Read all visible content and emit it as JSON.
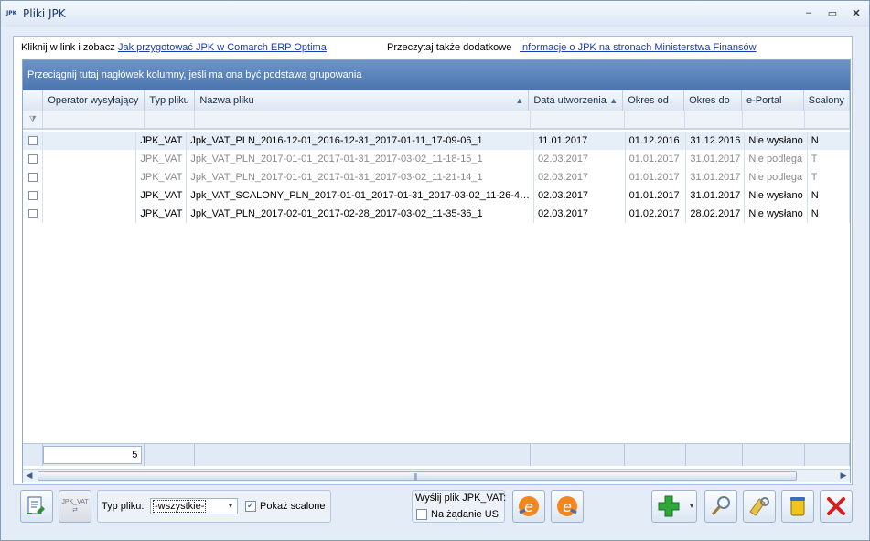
{
  "window": {
    "title": "Pliki JPK",
    "icon_text": "JPK",
    "minimize": "–",
    "maximize": "▭",
    "close": "✕"
  },
  "info": {
    "prefix1": "Kliknij w link i zobacz",
    "link1": "Jak przygotować JPK w Comarch ERP Optima",
    "prefix2": "Przeczytaj także dodatkowe",
    "link2": "Informacje o JPK na stronach Ministerstwa Finansów"
  },
  "grid": {
    "group_hint": "Przeciągnij tutaj nagłówek kolumny, jeśli ma ona być podstawą grupowania",
    "columns": [
      "",
      "Operator wysyłający",
      "Typ pliku",
      "Nazwa pliku",
      "Data utworzenia",
      "Okres od",
      "Okres do",
      "e-Portal",
      "Scalony"
    ],
    "rows": [
      {
        "operator": "",
        "typ": "JPK_VAT",
        "nazwa": "Jpk_VAT_PLN_2016-12-01_2016-12-31_2017-01-11_17-09-06_1",
        "data": "11.01.2017",
        "od": "01.12.2016",
        "do": "31.12.2016",
        "eportal": "Nie wysłano",
        "scalony": "N"
      },
      {
        "operator": "",
        "typ": "JPK_VAT",
        "nazwa": "Jpk_VAT_PLN_2017-01-01_2017-01-31_2017-03-02_11-18-15_1",
        "data": "02.03.2017",
        "od": "01.01.2017",
        "do": "31.01.2017",
        "eportal": "Nie podlega",
        "scalony": "T"
      },
      {
        "operator": "",
        "typ": "JPK_VAT",
        "nazwa": "Jpk_VAT_PLN_2017-01-01_2017-01-31_2017-03-02_11-21-14_1",
        "data": "02.03.2017",
        "od": "01.01.2017",
        "do": "31.01.2017",
        "eportal": "Nie podlega",
        "scalony": "T"
      },
      {
        "operator": "",
        "typ": "JPK_VAT",
        "nazwa": "Jpk_VAT_SCALONY_PLN_2017-01-01_2017-01-31_2017-03-02_11-26-4…",
        "data": "02.03.2017",
        "od": "01.01.2017",
        "do": "31.01.2017",
        "eportal": "Nie wysłano",
        "scalony": "N"
      },
      {
        "operator": "",
        "typ": "JPK_VAT",
        "nazwa": "Jpk_VAT_PLN_2017-02-01_2017-02-28_2017-03-02_11-35-36_1",
        "data": "02.03.2017",
        "od": "01.02.2017",
        "do": "28.02.2017",
        "eportal": "Nie wysłano",
        "scalony": "N"
      }
    ],
    "count": "5"
  },
  "bottom": {
    "jpk_vat_icon_text": "JPK_VAT",
    "typ_label": "Typ pliku:",
    "typ_value": "-wszystkie-",
    "pokaz_label": "Pokaż scalone",
    "wyslij_label": "Wyślij plik JPK_VAT:",
    "na_zadanie_label": "Na żądanie US"
  },
  "colors": {
    "accent": "#4a75ae",
    "gray_row": "#8a8a8a"
  }
}
